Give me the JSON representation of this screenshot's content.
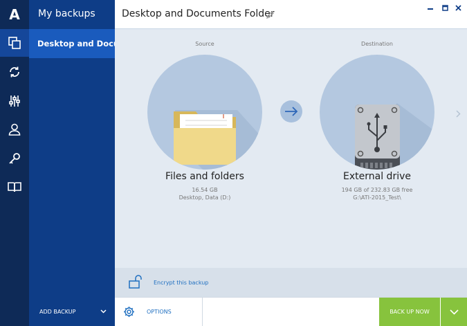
{
  "app": {
    "logo_letter": "A"
  },
  "rail": {
    "items": [
      {
        "icon": "backup-copy-icon",
        "active": true
      },
      {
        "icon": "sync-icon",
        "active": false
      },
      {
        "icon": "tools-icon",
        "active": false
      },
      {
        "icon": "account-icon",
        "active": false
      },
      {
        "icon": "key-icon",
        "active": false
      },
      {
        "icon": "book-icon",
        "active": false
      }
    ]
  },
  "panel": {
    "title": "My backups",
    "selected_item": "Desktop and Docu...",
    "add_backup_label": "ADD BACKUP"
  },
  "header": {
    "title": "Desktop and Documents Folder",
    "window_controls": [
      "minimize-icon",
      "maximize-icon",
      "close-icon"
    ]
  },
  "source": {
    "column_label": "Source",
    "title": "Files and folders",
    "size": "16.54 GB",
    "detail": "Desktop, Data (D:)"
  },
  "destination": {
    "column_label": "Destination",
    "title": "External drive",
    "size": "194 GB of 232.83 GB free",
    "detail": "G:\\ATI-2015_Test\\"
  },
  "encrypt": {
    "label": "Encrypt this backup"
  },
  "bottom": {
    "options_label": "OPTIONS",
    "backup_now_label": "BACK UP NOW"
  },
  "colors": {
    "rail_bg": "#0e2a57",
    "panel_bg": "#0e3d87",
    "selected_bg": "#1a5bbd",
    "accent_green": "#87c33d",
    "link_blue": "#1f6fc0",
    "circle_bg": "#b4c8e0"
  }
}
